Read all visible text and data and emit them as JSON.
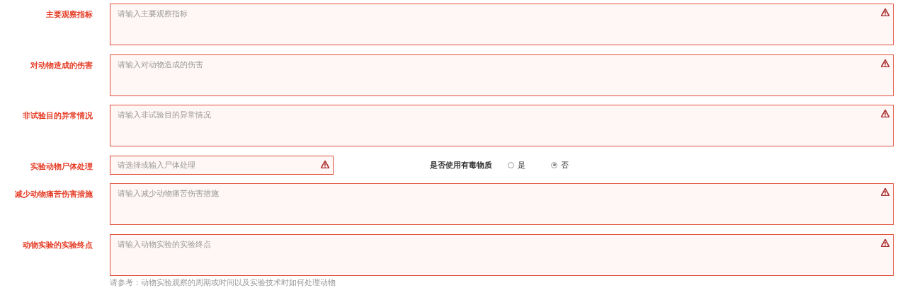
{
  "rows": [
    {
      "kind": "textarea",
      "label": "主要观察指标",
      "placeholder": "请输入主要观察指标",
      "invalid": true
    },
    {
      "kind": "textarea",
      "label": "对动物造成的伤害",
      "placeholder": "请输入对动物造成的伤害",
      "invalid": true
    },
    {
      "kind": "textarea",
      "label": "非试验目的异常情况",
      "placeholder": "请输入非试验目的异常情况",
      "invalid": true
    },
    {
      "kind": "combo",
      "label": "实验动物尸体处理",
      "placeholder": "请选择或输入尸体处理",
      "invalid": true,
      "radio_group": {
        "label": "是否使用有毒物质",
        "options": [
          {
            "label": "是",
            "selected": false
          },
          {
            "label": "否",
            "selected": true
          }
        ]
      }
    },
    {
      "kind": "textarea",
      "label": "减少动物痛苦伤害措施",
      "placeholder": "请输入减少动物痛苦伤害措施",
      "invalid": true
    },
    {
      "kind": "textarea",
      "label": "动物实验的实验终点",
      "placeholder": "请输入动物实验的实验终点",
      "invalid": true,
      "hint": "请参考：动物实验观察的周期或时间以及实验技术时如何处理动物"
    }
  ]
}
